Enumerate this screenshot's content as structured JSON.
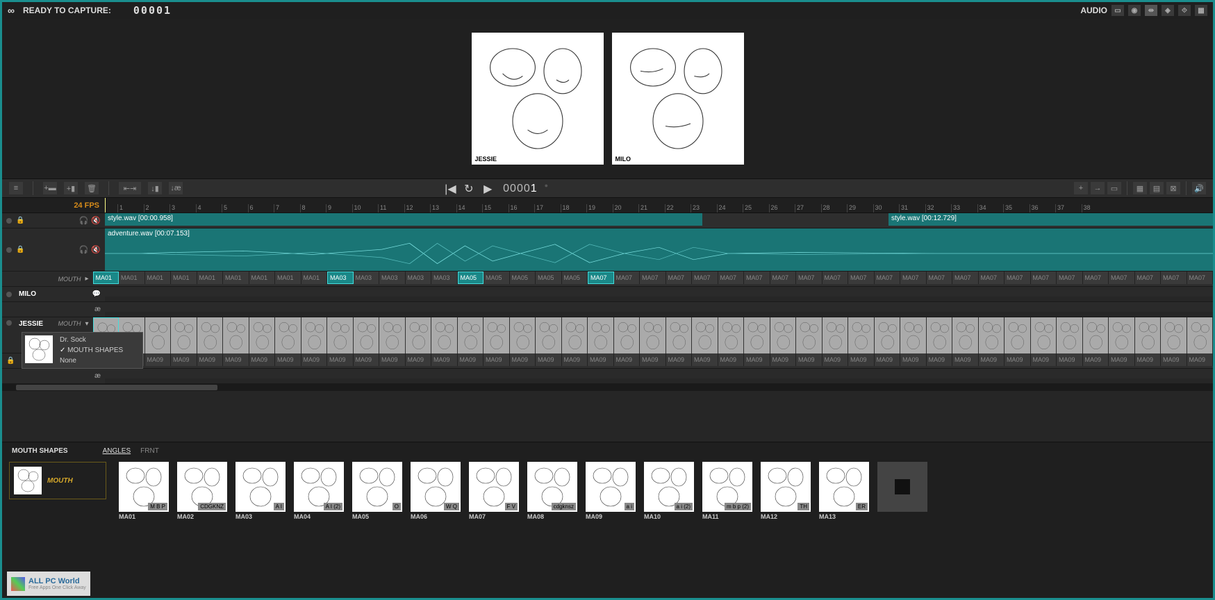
{
  "topbar": {
    "status": "READY TO CAPTURE:",
    "frame": "00001",
    "audio_label": "AUDIO"
  },
  "preview": [
    {
      "label": "JESSIE"
    },
    {
      "label": "MILO"
    }
  ],
  "playback": {
    "frame_prefix": "0000",
    "frame_last": "1"
  },
  "ruler": {
    "fps": "24 FPS",
    "ticks": [
      "1",
      "2",
      "3",
      "4",
      "5",
      "6",
      "7",
      "8",
      "9",
      "10",
      "11",
      "12",
      "13",
      "14",
      "15",
      "16",
      "17",
      "18",
      "19",
      "20",
      "21",
      "22",
      "23",
      "24",
      "25",
      "26",
      "27",
      "28",
      "29",
      "30",
      "31",
      "32",
      "33",
      "34",
      "35",
      "36",
      "37",
      "38"
    ]
  },
  "audio1": {
    "label": "style.wav [00:00.958]"
  },
  "audio1b": {
    "label": "style.wav [00:12.729]"
  },
  "audio2": {
    "label": "adventure.wav [00:07.153]"
  },
  "char1": {
    "name": "MILO",
    "sublabel": "MOUTH"
  },
  "char2": {
    "name": "JESSIE",
    "sublabel": "MOUTH"
  },
  "milo_mouth": [
    "MA01",
    "MA01",
    "MA01",
    "MA01",
    "MA01",
    "MA01",
    "MA01",
    "MA01",
    "MA01",
    "MA03",
    "MA03",
    "MA03",
    "MA03",
    "MA03",
    "MA05",
    "MA05",
    "MA05",
    "MA05",
    "MA05",
    "MA07",
    "MA07",
    "MA07",
    "MA07",
    "MA07",
    "MA07",
    "MA07",
    "MA07",
    "MA07",
    "MA07",
    "MA07",
    "MA07",
    "MA07",
    "MA07",
    "MA07",
    "MA07",
    "MA07",
    "MA07",
    "MA07",
    "MA07",
    "MA07",
    "MA07",
    "MA07",
    "MA07"
  ],
  "milo_active": [
    0,
    9,
    14,
    19
  ],
  "jessie_mouth": [
    "MA09",
    "MA09",
    "MA09",
    "MA09",
    "MA09",
    "MA09",
    "MA09",
    "MA09",
    "MA09",
    "MA09",
    "MA09",
    "MA09",
    "MA09",
    "MA09",
    "MA09",
    "MA09",
    "MA09",
    "MA09",
    "MA09",
    "MA09",
    "MA09",
    "MA09",
    "MA09",
    "MA09",
    "MA09",
    "MA09",
    "MA09",
    "MA09",
    "MA09",
    "MA09",
    "MA09",
    "MA09",
    "MA09",
    "MA09",
    "MA09",
    "MA09",
    "MA09",
    "MA09",
    "MA09",
    "MA09",
    "MA09",
    "MA09",
    "MA09"
  ],
  "popup": {
    "items": [
      "Dr. Sock",
      "MOUTH SHAPES",
      "None"
    ],
    "checked": 1
  },
  "bottom": {
    "title": "MOUTH SHAPES",
    "tabs": [
      "ANGLES",
      "FRNT"
    ],
    "active_tab": 0,
    "category": "MOUTH"
  },
  "shapes": [
    {
      "id": "MA01",
      "tag": "M B P"
    },
    {
      "id": "MA02",
      "tag": "CDGKNZ"
    },
    {
      "id": "MA03",
      "tag": "A I"
    },
    {
      "id": "MA04",
      "tag": "A I (2)"
    },
    {
      "id": "MA05",
      "tag": "O"
    },
    {
      "id": "MA06",
      "tag": "W Q"
    },
    {
      "id": "MA07",
      "tag": "F V"
    },
    {
      "id": "MA08",
      "tag": "cdgknsz"
    },
    {
      "id": "MA09",
      "tag": "a i"
    },
    {
      "id": "MA10",
      "tag": "a i (2)"
    },
    {
      "id": "MA11",
      "tag": "m b p (2)"
    },
    {
      "id": "MA12",
      "tag": "TH"
    },
    {
      "id": "MA13",
      "tag": "ER"
    }
  ],
  "ae": "æ",
  "watermark": {
    "text": "ALL PC World",
    "sub": "Free Apps One Click Away"
  }
}
